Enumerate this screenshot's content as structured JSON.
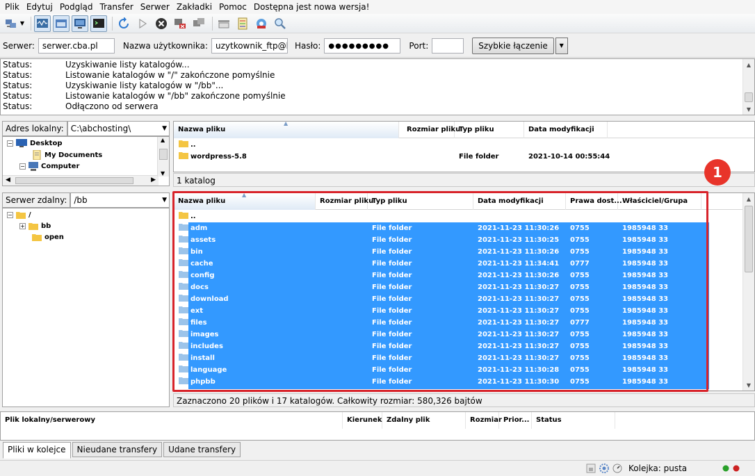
{
  "menu": [
    "Plik",
    "Edytuj",
    "Podgląd",
    "Transfer",
    "Serwer",
    "Zakładki",
    "Pomoc",
    "Dostępna jest nowa wersja!"
  ],
  "quickconnect": {
    "server_label": "Serwer:",
    "server_value": "serwer.cba.pl",
    "user_label": "Nazwa użytkownika:",
    "user_value": "uzytkownik_ftp@ha",
    "pass_label": "Hasło:",
    "pass_value": "●●●●●●●●●",
    "port_label": "Port:",
    "port_value": "",
    "connect_label": "Szybkie łączenie"
  },
  "log": [
    {
      "label": "Status:",
      "text": "Uzyskiwanie listy katalogów..."
    },
    {
      "label": "Status:",
      "text": "Listowanie katalogów w \"/\" zakończone pomyślnie"
    },
    {
      "label": "Status:",
      "text": "Uzyskiwanie listy katalogów w \"/bb\"..."
    },
    {
      "label": "Status:",
      "text": "Listowanie katalogów w \"/bb\" zakończone pomyślnie"
    },
    {
      "label": "Status:",
      "text": "Odłączono od serwera"
    }
  ],
  "local": {
    "addr_label": "Adres lokalny:",
    "addr_value": "C:\\abchosting\\",
    "tree": [
      "Desktop",
      "My Documents",
      "Computer"
    ],
    "columns": [
      "Nazwa pliku",
      "Rozmiar pliku",
      "Typ pliku",
      "Data modyfikacji"
    ],
    "files": [
      {
        "name": "..",
        "type": "",
        "date": ""
      },
      {
        "name": "wordpress-5.8",
        "type": "File folder",
        "date": "2021-10-14 00:55:44"
      }
    ],
    "status": "1 katalog"
  },
  "remote": {
    "addr_label": "Serwer zdalny:",
    "addr_value": "/bb",
    "tree": [
      "/",
      "bb",
      "open"
    ],
    "columns": [
      "Nazwa pliku",
      "Rozmiar pliku",
      "Typ pliku",
      "Data modyfikacji",
      "Prawa dost...",
      "Właściciel/Grupa"
    ],
    "parent": "..",
    "files": [
      {
        "name": "adm",
        "type": "File folder",
        "date": "2021-11-23 11:30:26",
        "perm": "0755",
        "owner": "1985948 33"
      },
      {
        "name": "assets",
        "type": "File folder",
        "date": "2021-11-23 11:30:25",
        "perm": "0755",
        "owner": "1985948 33"
      },
      {
        "name": "bin",
        "type": "File folder",
        "date": "2021-11-23 11:30:26",
        "perm": "0755",
        "owner": "1985948 33"
      },
      {
        "name": "cache",
        "type": "File folder",
        "date": "2021-11-23 11:34:41",
        "perm": "0777",
        "owner": "1985948 33"
      },
      {
        "name": "config",
        "type": "File folder",
        "date": "2021-11-23 11:30:26",
        "perm": "0755",
        "owner": "1985948 33"
      },
      {
        "name": "docs",
        "type": "File folder",
        "date": "2021-11-23 11:30:27",
        "perm": "0755",
        "owner": "1985948 33"
      },
      {
        "name": "download",
        "type": "File folder",
        "date": "2021-11-23 11:30:27",
        "perm": "0755",
        "owner": "1985948 33"
      },
      {
        "name": "ext",
        "type": "File folder",
        "date": "2021-11-23 11:30:27",
        "perm": "0755",
        "owner": "1985948 33"
      },
      {
        "name": "files",
        "type": "File folder",
        "date": "2021-11-23 11:30:27",
        "perm": "0777",
        "owner": "1985948 33"
      },
      {
        "name": "images",
        "type": "File folder",
        "date": "2021-11-23 11:30:27",
        "perm": "0755",
        "owner": "1985948 33"
      },
      {
        "name": "includes",
        "type": "File folder",
        "date": "2021-11-23 11:30:27",
        "perm": "0755",
        "owner": "1985948 33"
      },
      {
        "name": "install",
        "type": "File folder",
        "date": "2021-11-23 11:30:27",
        "perm": "0755",
        "owner": "1985948 33"
      },
      {
        "name": "language",
        "type": "File folder",
        "date": "2021-11-23 11:30:28",
        "perm": "0755",
        "owner": "1985948 33"
      },
      {
        "name": "phpbb",
        "type": "File folder",
        "date": "2021-11-23 11:30:30",
        "perm": "0755",
        "owner": "1985948 33"
      }
    ],
    "status": "Zaznaczono 20 plików i 17 katalogów. Całkowity rozmiar: 580,326 bajtów"
  },
  "queue": {
    "columns": [
      "Plik lokalny/serwerowy",
      "Kierunek",
      "Zdalny plik",
      "Rozmiar",
      "Prior...",
      "Status"
    ]
  },
  "tabs": [
    "Pliki w kolejce",
    "Nieudane transfery",
    "Udane transfery"
  ],
  "bottom": {
    "queue_label": "Kolejka: pusta"
  },
  "annotation": {
    "number": "1",
    "color": "#e8342a"
  },
  "colors": {
    "selection": "#3399ff",
    "highlight": "#d8232a",
    "folder": "#f4c542"
  }
}
